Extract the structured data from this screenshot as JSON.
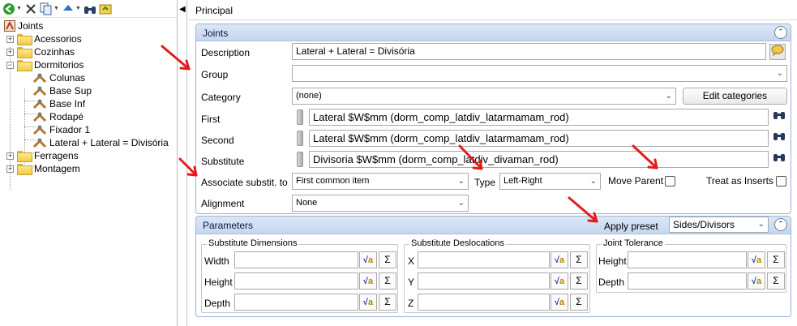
{
  "tree": {
    "root": "Joints",
    "items": [
      {
        "label": "Acessorios"
      },
      {
        "label": "Cozinhas"
      },
      {
        "label": "Dormitorios"
      },
      {
        "label": "Colunas"
      },
      {
        "label": "Base Sup"
      },
      {
        "label": "Base Inf"
      },
      {
        "label": "Rodapé"
      },
      {
        "label": "Fixador 1"
      },
      {
        "label": "Lateral + Lateral = Divisória"
      },
      {
        "label": "Ferragens"
      },
      {
        "label": "Montagem"
      }
    ]
  },
  "page_title": "Principal",
  "joints_panel": {
    "title": "Joints",
    "description_label": "Description",
    "description_value": "Lateral + Lateral = Divisória",
    "group_label": "Group",
    "group_value": "",
    "category_label": "Category",
    "category_value": "(none)",
    "edit_categories_label": "Edit categories",
    "first_label": "First",
    "first_value": "Lateral $W$mm (dorm_comp_latdiv_latarmamam_rod)",
    "second_label": "Second",
    "second_value": "Lateral $W$mm (dorm_comp_latdiv_latarmamam_rod)",
    "substitute_label": "Substitute",
    "substitute_value": "Divisoria $W$mm (dorm_comp_latdiv_divaman_rod)",
    "associate_label": "Associate substit. to",
    "associate_value": "First common item",
    "type_label": "Type",
    "type_value": "Left-Right",
    "move_parent_label": "Move Parent",
    "treat_inserts_label": "Treat as Inserts",
    "alignment_label": "Alignment",
    "alignment_value": "None"
  },
  "parameters_panel": {
    "title": "Parameters",
    "apply_preset_label": "Apply preset",
    "preset_value": "Sides/Divisors",
    "dimensions": {
      "title": "Substitute Dimensions",
      "rows": [
        "Width",
        "Height",
        "Depth"
      ]
    },
    "deslocations": {
      "title": "Substitute Deslocations",
      "rows": [
        "X",
        "Y",
        "Z"
      ]
    },
    "tolerance": {
      "title": "Joint Tolerance",
      "rows": [
        "Height",
        "Depth"
      ]
    },
    "sigma_glyph": "Σ"
  },
  "icons": {
    "back": "back-arrow-icon",
    "delete": "delete-x-icon",
    "copy": "copy-icon",
    "up": "move-up-icon",
    "find": "binoculars-icon",
    "refresh": "refresh-icon",
    "chat": "speech-bubble-icon",
    "formula": "sqrt-formula-icon",
    "sum": "sigma-icon"
  },
  "colors": {
    "panel_header_top": "#dbe7f7",
    "panel_header_bottom": "#c5d6ee",
    "panel_border": "#9db3d6",
    "annotation_arrow": "#e31c1c",
    "folder": "#f2c94c"
  }
}
